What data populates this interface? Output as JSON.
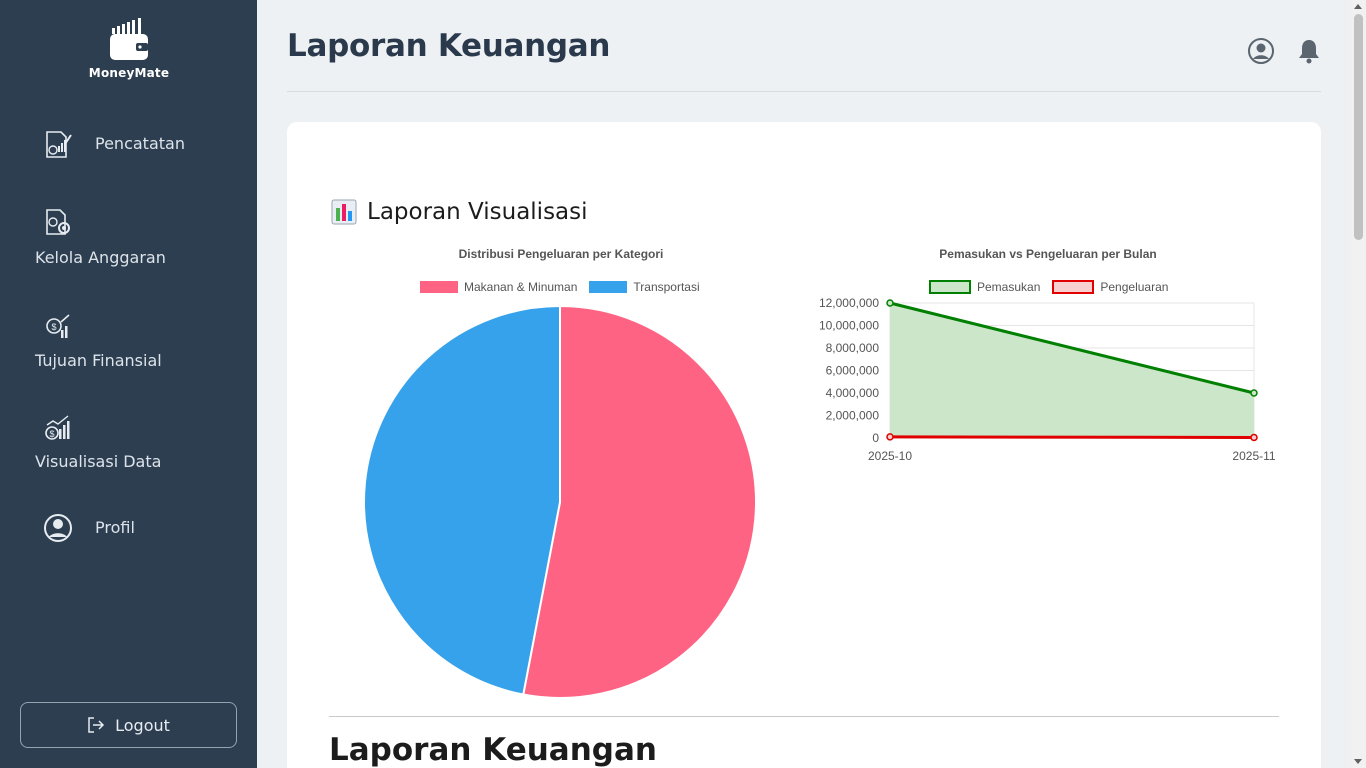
{
  "app": {
    "name": "MoneyMate"
  },
  "sidebar": {
    "items": [
      {
        "label": "Pencatatan",
        "icon": "notes-chart-icon"
      },
      {
        "label": "Kelola Anggaran",
        "icon": "budget-gear-icon"
      },
      {
        "label": "Tujuan Finansial",
        "icon": "goal-money-icon"
      },
      {
        "label": "Visualisasi Data",
        "icon": "analytics-icon"
      },
      {
        "label": "Profil",
        "icon": "user-circle-icon"
      }
    ],
    "logout_label": "Logout"
  },
  "header": {
    "title": "Laporan Keuangan",
    "icons": [
      "user-circle-icon",
      "bell-icon"
    ]
  },
  "main": {
    "section_title": "Laporan Visualisasi",
    "bottom_title": "Laporan Keuangan"
  },
  "colors": {
    "sidebar_bg": "#2d3e50",
    "pie_food": "#ff6384",
    "pie_transport": "#36a2eb",
    "income_line": "#008000",
    "income_fill": "#cce6c9",
    "expense_line": "#e00000",
    "expense_fill": "#f8d0d0"
  },
  "chart_data": [
    {
      "type": "pie",
      "title": "Distribusi Pengeluaran per Kategori",
      "legend_position": "top",
      "categories": [
        "Makanan & Minuman",
        "Transportasi"
      ],
      "values": [
        53,
        47
      ],
      "colors": [
        "#ff6384",
        "#36a2eb"
      ]
    },
    {
      "type": "area",
      "title": "Pemasukan vs Pengeluaran per Bulan",
      "legend_position": "top",
      "x": [
        "2025-10",
        "2025-11"
      ],
      "series": [
        {
          "name": "Pemasukan",
          "values": [
            12000000,
            4000000
          ],
          "color": "#008000"
        },
        {
          "name": "Pengeluaran",
          "values": [
            100000,
            50000
          ],
          "color": "#e00000"
        }
      ],
      "ylim": [
        0,
        12000000
      ],
      "yticks": [
        "12,000,000",
        "10,000,000",
        "8,000,000",
        "6,000,000",
        "4,000,000",
        "2,000,000",
        "0"
      ],
      "grid": true
    }
  ]
}
